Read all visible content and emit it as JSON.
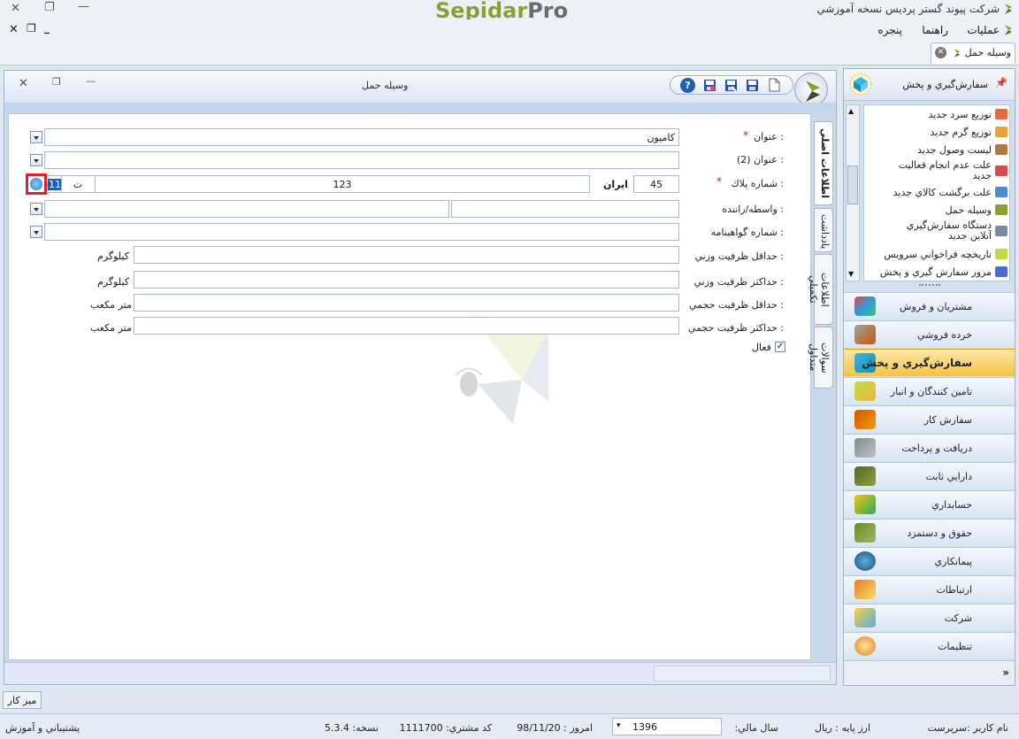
{
  "app": {
    "title": "شرکت پیوند گستر پردیس نسخه آموزشي",
    "logo_part1": "Sepidar",
    "logo_part2": "Pro",
    "logo_color1": "#8aa033",
    "logo_color2": "#6c6c6c"
  },
  "menu": {
    "items": [
      "عمليات",
      "راهنما",
      "پنجره"
    ]
  },
  "document_tab": {
    "label": "وسيله حمل"
  },
  "form": {
    "title": "وسيله حمل",
    "fields": {
      "title_label": "عنوان :",
      "title_value": "كاميون",
      "title2_label": "عنوان (2) :",
      "plate_label": "شماره پلاك :",
      "plate_part1": "45",
      "plate_iran": "ايران",
      "plate_part2": "123",
      "plate_letter": "ت",
      "plate_part3": "11",
      "broker_label": "واسطه/راننده :",
      "cert_label": "شماره گواهينامه :",
      "min_weight_label": "حداقل ظرفيت وزني :",
      "max_weight_label": "حداكثر ظرفيت وزني :",
      "min_volume_label": "حداقل ظرفيت حجمي :",
      "max_volume_label": "حداكثر ظرفيت حجمي :",
      "unit_kg": "كيلوگرم",
      "unit_m3": "متر مكعب",
      "active_label": "فعال",
      "active_checked": true
    },
    "side_tabs": [
      "اطلاعات اصلي",
      "يادداشت",
      "اطلاعات تكميلي",
      "سوالات متداول"
    ]
  },
  "right_panel": {
    "header": "سفارش‌گيري و پخش",
    "list_items": [
      "توزيع سرد جديد",
      "توزيع گرم جديد",
      "ليست وصول جديد",
      "علت عدم انجام فعاليت جديد",
      "علت برگشت كالاي جديد",
      "وسيله حمل",
      "دستگاه سفارش‌گيري آنلاين جديد",
      "تاريخچه فراخواني سرويس",
      "مرور سفارش گيري و پخش"
    ],
    "nav": [
      "مشتريان و فروش",
      "خرده فروشي",
      "سفارش‌گيري و پخش",
      "تامين كنندگان و انبار",
      "سفارش كار",
      "دريافت و پرداخت",
      "دارايي ثابت",
      "حسابداري",
      "حقوق و دستمزد",
      "پيمانكاري",
      "ارتباطات",
      "شركت",
      "تنظيمات"
    ],
    "nav_active_index": 2
  },
  "taskbar": {
    "desk_label": "ميز كار"
  },
  "status": {
    "user": "نام كاربر :سرپرست",
    "currency": "ارز پايه :   ريال",
    "fiscal_year_label": "سال مالي:",
    "fiscal_year_value": "1396",
    "today": "امروز :   98/11/20",
    "customer_code": "كد مشتري:   1111700",
    "version": "نسخه:   5.3.4",
    "support": "پشتيباني و آموزش"
  }
}
